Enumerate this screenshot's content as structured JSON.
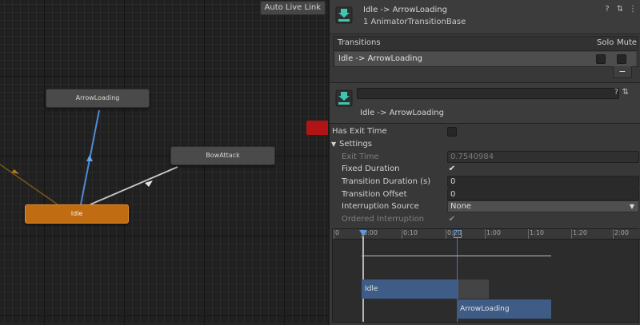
{
  "graph": {
    "auto_live_link": "Auto Live Link",
    "states": {
      "arrow_loading": "ArrowLoading",
      "bow_attack": "BowAttack",
      "idle": "Idle"
    },
    "colors": {
      "default_state": "#c06c12",
      "state": "#4a4a4a",
      "selected_transition": "#4e8bd4",
      "transition": "#c8c8c8"
    }
  },
  "inspector": {
    "header": {
      "title": "Idle -> ArrowLoading",
      "subtitle": "1 AnimatorTransitionBase",
      "icons": [
        "help-icon",
        "preset-icon",
        "more-icon"
      ]
    },
    "transitions": {
      "label": "Transitions",
      "solo_label": "Solo",
      "mute_label": "Mute",
      "items": [
        {
          "name": "Idle -> ArrowLoading",
          "solo": false,
          "mute": false
        }
      ],
      "remove_label": "−"
    },
    "transition": {
      "name_value": "",
      "title": "Idle -> ArrowLoading"
    },
    "properties": {
      "has_exit_time_label": "Has Exit Time",
      "has_exit_time": false,
      "settings_label": "Settings",
      "exit_time_label": "Exit Time",
      "exit_time_value": "0.7540984",
      "fixed_duration_label": "Fixed Duration",
      "fixed_duration": true,
      "transition_duration_label": "Transition Duration (s)",
      "transition_duration_value": "0",
      "transition_offset_label": "Transition Offset",
      "transition_offset_value": "0",
      "interruption_source_label": "Interruption Source",
      "interruption_source_value": "None",
      "ordered_interruption_label": "Ordered Interruption",
      "ordered_interruption": true
    },
    "timeline": {
      "ticks": [
        "0",
        "0:00",
        "0:10",
        "0:20",
        "1:00",
        "1:10",
        "1:20",
        "2:00"
      ],
      "idle_bar": "Idle",
      "arrow_loading_bar": "ArrowLoading"
    }
  }
}
